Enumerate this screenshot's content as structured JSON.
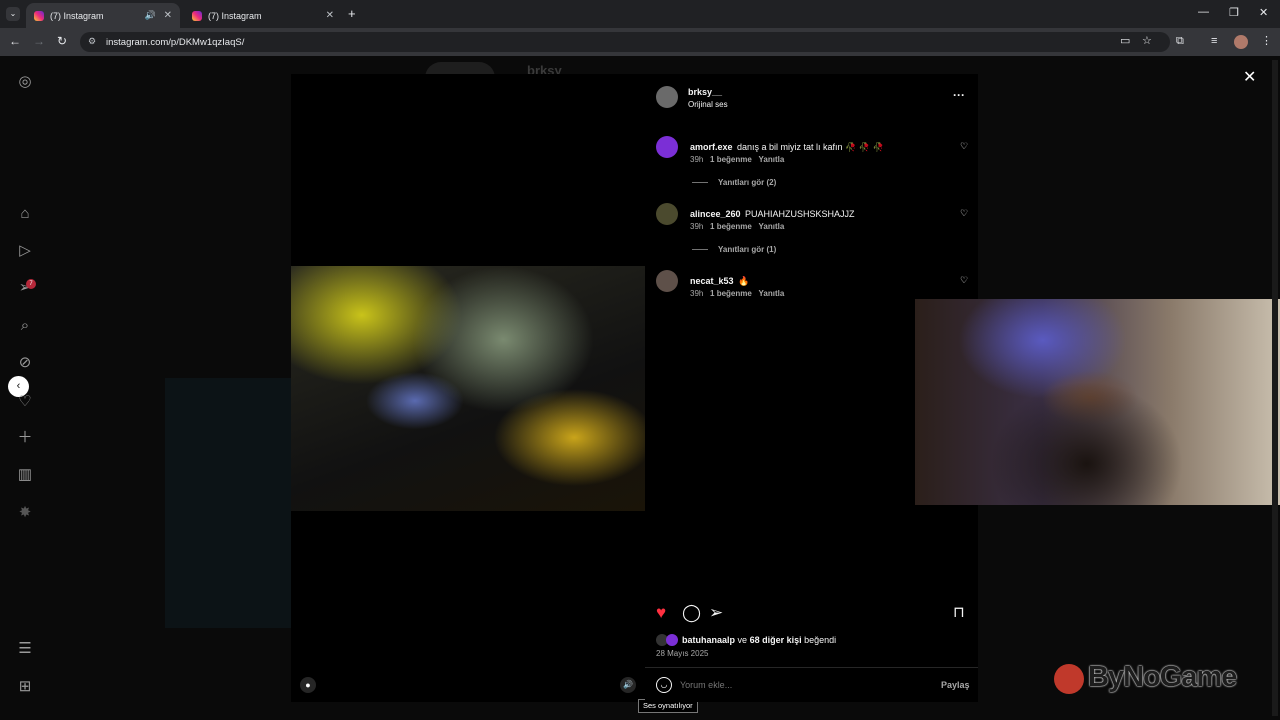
{
  "browser": {
    "tabs": [
      {
        "label": "(7) Instagram",
        "active": true
      },
      {
        "label": "(7) Instagram",
        "active": false
      }
    ],
    "url": "instagram.com/p/DKMw1qzIaqS/",
    "new_tab": "+",
    "minimize": "—",
    "restore": "❐",
    "close": "✕"
  },
  "background_post": {
    "username": "brksy"
  },
  "post": {
    "author": "brksy__",
    "audio": "Orijinal ses",
    "more": "···",
    "comments": [
      {
        "username": "amorf.exe",
        "text": "danış a bil miyiz tat lı kafın 🥀 🥀 🥀",
        "time": "39h",
        "likes": "1 beğenme",
        "reply": "Yanıtla",
        "view_replies": "Yanıtları gör (2)",
        "avatar_color": "#7b2fd6"
      },
      {
        "username": "alincee_260",
        "text": "PUAHIAHZUSHSKSHAJJZ",
        "time": "39h",
        "likes": "1 beğenme",
        "reply": "Yanıtla",
        "view_replies": "Yanıtları gör (1)",
        "avatar_color": "#4b4a2e"
      },
      {
        "username": "necat_k53",
        "text": "🔥",
        "time": "39h",
        "likes": "1 beğenme",
        "reply": "Yanıtla",
        "view_replies": "",
        "avatar_color": "#5e5049"
      }
    ],
    "liked_by_user": "batuhanaalp",
    "liked_by_connector": "ve",
    "liked_by_others": "68 diğer kişi",
    "liked_by_suffix": "beğendi",
    "date": "28 Mayıs 2025",
    "comment_placeholder": "Yorum ekle...",
    "share_label": "Paylaş",
    "liked": true,
    "accent_like": "#ff3040"
  },
  "tooltip": "Ses oynatılıyor",
  "watermark": "ByNoGame",
  "icons": {
    "sidebar": [
      "instagram-icon",
      "home-icon",
      "reels-icon",
      "direct-icon",
      "search-icon",
      "explore-icon",
      "notifications-icon",
      "create-icon",
      "dashboard-icon",
      "meta-icon",
      "menu-icon",
      "more-icon"
    ]
  }
}
